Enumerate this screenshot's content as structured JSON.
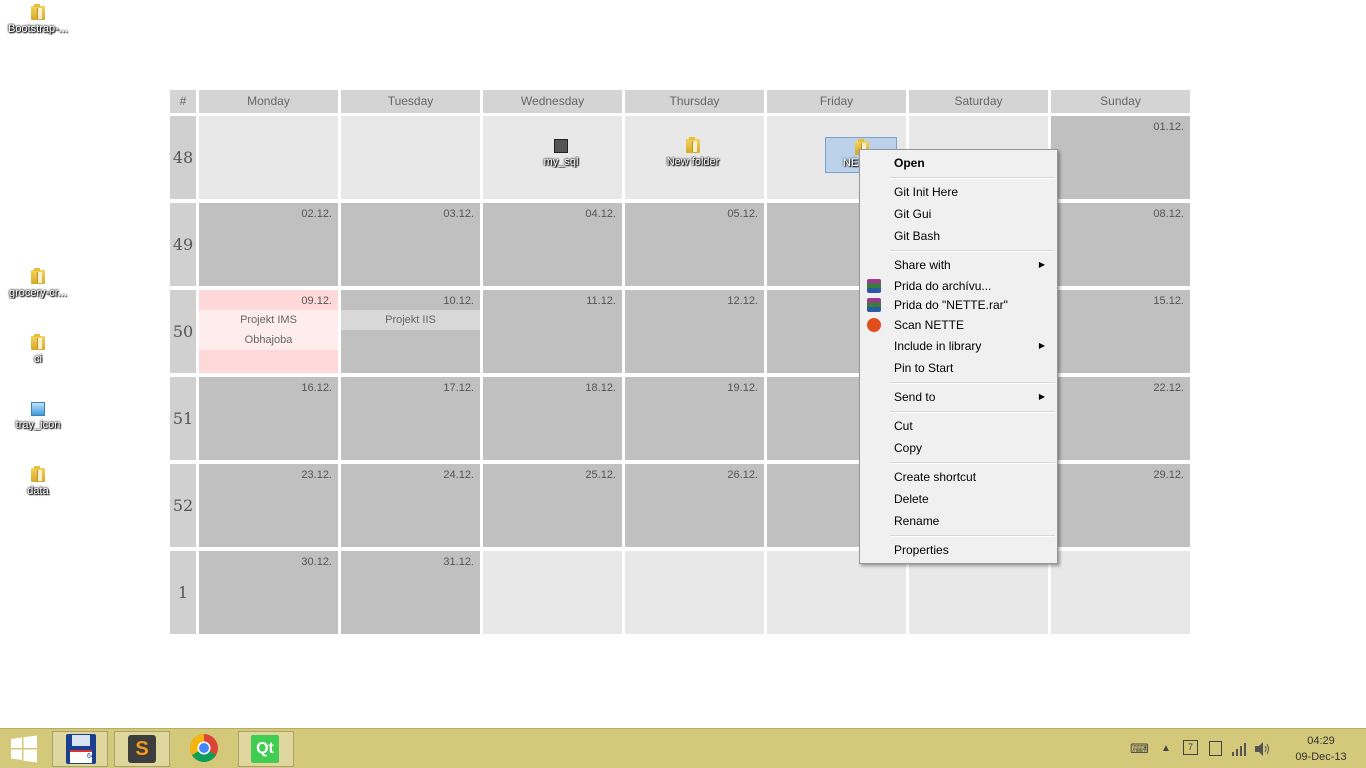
{
  "desktop_icons": [
    {
      "label": "Bootstrap-...",
      "icon": "folder-icon"
    },
    {
      "label": "grocery-cr...",
      "icon": "folder-icon"
    },
    {
      "label": "ci",
      "icon": "folder-icon"
    },
    {
      "label": "tray_icon",
      "icon": "image-file-icon"
    },
    {
      "label": "data",
      "icon": "folder-icon"
    }
  ],
  "calendar": {
    "corner": "#",
    "days": [
      "Monday",
      "Tuesday",
      "Wednesday",
      "Thursday",
      "Friday",
      "Saturday",
      "Sunday"
    ],
    "weeks": [
      "48",
      "49",
      "50",
      "51",
      "52",
      "1"
    ],
    "dates": {
      "w48_sun": "01.12.",
      "w49": [
        "02.12.",
        "03.12.",
        "04.12.",
        "05.12.",
        "08.12."
      ],
      "w50": [
        "09.12.",
        "10.12.",
        "11.12.",
        "12.12.",
        "15.12."
      ],
      "w51": [
        "16.12.",
        "17.12.",
        "18.12.",
        "19.12.",
        "22.12."
      ],
      "w52": [
        "23.12.",
        "24.12.",
        "25.12.",
        "26.12.",
        "29.12."
      ],
      "w1": [
        "30.12.",
        "31.12."
      ]
    },
    "events": {
      "mon_1": "Projekt IMS",
      "mon_2": "Obhajoba",
      "tue_1": "Projekt IIS"
    },
    "cell_items": [
      {
        "label": "my_sql",
        "icon": "sql-file-icon"
      },
      {
        "label": "New folder",
        "icon": "folder-icon"
      },
      {
        "label": "NE",
        "icon": "folder-icon"
      }
    ]
  },
  "context_menu": {
    "items": [
      {
        "label": "Open"
      },
      {
        "label": "Git Init Here"
      },
      {
        "label": "Git Gui"
      },
      {
        "label": "Git Bash"
      },
      {
        "label": "Share with"
      },
      {
        "label": "Prida do archívu...",
        "icon": "winrar-icon"
      },
      {
        "label": "Prida do \"NETTE.rar\"",
        "icon": "winrar-icon"
      },
      {
        "label": "Scan NETTE",
        "icon": "avast-icon"
      },
      {
        "label": "Include in library"
      },
      {
        "label": "Pin to Start"
      },
      {
        "label": "Send to"
      },
      {
        "label": "Cut"
      },
      {
        "label": "Copy"
      },
      {
        "label": "Create shortcut"
      },
      {
        "label": "Delete"
      },
      {
        "label": "Rename"
      },
      {
        "label": "Properties"
      }
    ]
  },
  "taskbar": {
    "buttons": [
      "start-icon",
      "floppy-app-icon",
      "sublime-text-icon",
      "chrome-icon",
      "qt-creator-icon"
    ],
    "floppy_text": "64",
    "sublime_text": "S",
    "qt_text": "Qt",
    "tray_icons": [
      "keyboard-icon",
      "show-hidden-icons-arrow",
      "calendar-tray-icon",
      "device-icon",
      "network-signal-icon",
      "volume-icon"
    ],
    "tray_calendar_day": "7",
    "clock": {
      "time": "04:29",
      "date": "09-Dec-13"
    }
  },
  "colors": {
    "taskbar": "#d4c87a",
    "cell_dark": "#c0c0c0",
    "cell_light": "#e8e8e8",
    "today_pink": "#ffd9d9",
    "menu_bg": "#f0f0f0"
  }
}
